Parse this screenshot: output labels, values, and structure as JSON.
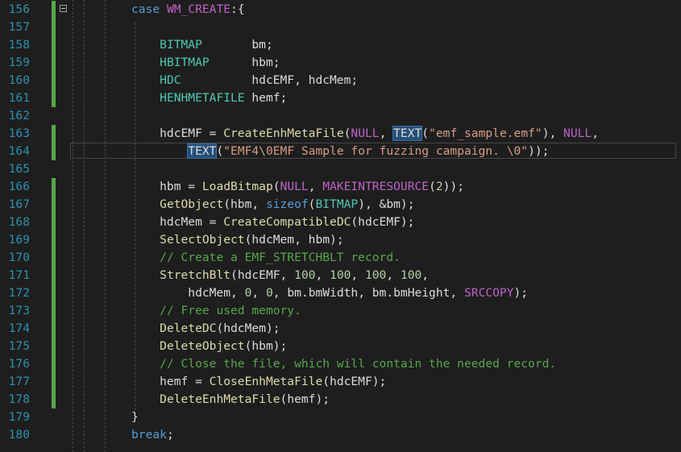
{
  "colors": {
    "background": "#1e1e1e",
    "line_number": "#2b91af",
    "keyword": "#569cd6",
    "type": "#4ec9b0",
    "macro": "#bd63c5",
    "function": "#dcdcaa",
    "string": "#d69d85",
    "number": "#b5cea8",
    "comment": "#57a64a",
    "identifier": "#dcdcdc",
    "change_bar": "#57a64a",
    "selection_highlight": "#264f78"
  },
  "icons": {
    "fold": "collapse-minus-box"
  },
  "editor": {
    "current_line": 164,
    "highlighted_word": "TEXT",
    "lines": [
      {
        "num": "156",
        "tokens": [
          [
            "kw",
            "case"
          ],
          [
            "id",
            " "
          ],
          [
            "mac",
            "WM_CREATE"
          ],
          [
            "id",
            ":{"
          ]
        ]
      },
      {
        "num": "157",
        "tokens": []
      },
      {
        "num": "158",
        "tokens": [
          [
            "id",
            "    "
          ],
          [
            "ty",
            "BITMAP"
          ],
          [
            "id",
            "       bm;"
          ]
        ]
      },
      {
        "num": "159",
        "tokens": [
          [
            "id",
            "    "
          ],
          [
            "ty",
            "HBITMAP"
          ],
          [
            "id",
            "      hbm;"
          ]
        ]
      },
      {
        "num": "160",
        "tokens": [
          [
            "id",
            "    "
          ],
          [
            "ty",
            "HDC"
          ],
          [
            "id",
            "          hdcEMF, hdcMem;"
          ]
        ]
      },
      {
        "num": "161",
        "tokens": [
          [
            "id",
            "    "
          ],
          [
            "ty",
            "HENHMETAFILE"
          ],
          [
            "id",
            " hemf;"
          ]
        ]
      },
      {
        "num": "162",
        "tokens": []
      },
      {
        "num": "163",
        "tokens": [
          [
            "id",
            "    hdcEMF = "
          ],
          [
            "fn",
            "CreateEnhMetaFile"
          ],
          [
            "id",
            "("
          ],
          [
            "mac",
            "NULL"
          ],
          [
            "id",
            ", "
          ],
          [
            "hl",
            "TEXT"
          ],
          [
            "id",
            "("
          ],
          [
            "str",
            "\"emf_sample.emf\""
          ],
          [
            "id",
            "), "
          ],
          [
            "mac",
            "NULL"
          ],
          [
            "id",
            ","
          ]
        ]
      },
      {
        "num": "164",
        "tokens": [
          [
            "id",
            "        "
          ],
          [
            "hl",
            "TEXT"
          ],
          [
            "id",
            "("
          ],
          [
            "str",
            "\"EMF4\\0EMF Sample for fuzzing campaign. \\0\""
          ],
          [
            "id",
            "));"
          ]
        ]
      },
      {
        "num": "165",
        "tokens": []
      },
      {
        "num": "166",
        "tokens": [
          [
            "id",
            "    hbm = "
          ],
          [
            "fn",
            "LoadBitmap"
          ],
          [
            "id",
            "("
          ],
          [
            "mac",
            "NULL"
          ],
          [
            "id",
            ", "
          ],
          [
            "mac",
            "MAKEINTRESOURCE"
          ],
          [
            "id",
            "("
          ],
          [
            "num",
            "2"
          ],
          [
            "id",
            "));"
          ]
        ]
      },
      {
        "num": "167",
        "tokens": [
          [
            "id",
            "    "
          ],
          [
            "fn",
            "GetObject"
          ],
          [
            "id",
            "(hbm, "
          ],
          [
            "kw",
            "sizeof"
          ],
          [
            "id",
            "("
          ],
          [
            "ty",
            "BITMAP"
          ],
          [
            "id",
            "), &bm);"
          ]
        ]
      },
      {
        "num": "168",
        "tokens": [
          [
            "id",
            "    hdcMem = "
          ],
          [
            "fn",
            "CreateCompatibleDC"
          ],
          [
            "id",
            "(hdcEMF);"
          ]
        ]
      },
      {
        "num": "169",
        "tokens": [
          [
            "id",
            "    "
          ],
          [
            "fn",
            "SelectObject"
          ],
          [
            "id",
            "(hdcMem, hbm);"
          ]
        ]
      },
      {
        "num": "170",
        "tokens": [
          [
            "id",
            "    "
          ],
          [
            "com",
            "// Create a EMF_STRETCHBLT record."
          ]
        ]
      },
      {
        "num": "171",
        "tokens": [
          [
            "id",
            "    "
          ],
          [
            "fn",
            "StretchBlt"
          ],
          [
            "id",
            "(hdcEMF, "
          ],
          [
            "num",
            "100"
          ],
          [
            "id",
            ", "
          ],
          [
            "num",
            "100"
          ],
          [
            "id",
            ", "
          ],
          [
            "num",
            "100"
          ],
          [
            "id",
            ", "
          ],
          [
            "num",
            "100"
          ],
          [
            "id",
            ","
          ]
        ]
      },
      {
        "num": "172",
        "tokens": [
          [
            "id",
            "        hdcMem, "
          ],
          [
            "num",
            "0"
          ],
          [
            "id",
            ", "
          ],
          [
            "num",
            "0"
          ],
          [
            "id",
            ", bm.bmWidth, bm.bmHeight, "
          ],
          [
            "mac",
            "SRCCOPY"
          ],
          [
            "id",
            ");"
          ]
        ]
      },
      {
        "num": "173",
        "tokens": [
          [
            "id",
            "    "
          ],
          [
            "com",
            "// Free used memory."
          ]
        ]
      },
      {
        "num": "174",
        "tokens": [
          [
            "id",
            "    "
          ],
          [
            "fn",
            "DeleteDC"
          ],
          [
            "id",
            "(hdcMem);"
          ]
        ]
      },
      {
        "num": "175",
        "tokens": [
          [
            "id",
            "    "
          ],
          [
            "fn",
            "DeleteObject"
          ],
          [
            "id",
            "(hbm);"
          ]
        ]
      },
      {
        "num": "176",
        "tokens": [
          [
            "id",
            "    "
          ],
          [
            "com",
            "// Close the file, which will contain the needed record."
          ]
        ]
      },
      {
        "num": "177",
        "tokens": [
          [
            "id",
            "    hemf = "
          ],
          [
            "fn",
            "CloseEnhMetaFile"
          ],
          [
            "id",
            "(hdcEMF);"
          ]
        ]
      },
      {
        "num": "178",
        "tokens": [
          [
            "id",
            "    "
          ],
          [
            "fn",
            "DeleteEnhMetaFile"
          ],
          [
            "id",
            "(hemf);"
          ]
        ]
      },
      {
        "num": "179",
        "tokens": [
          [
            "id",
            "}"
          ]
        ]
      },
      {
        "num": "180",
        "tokens": [
          [
            "kw",
            "break"
          ],
          [
            "id",
            ";"
          ]
        ]
      }
    ]
  }
}
